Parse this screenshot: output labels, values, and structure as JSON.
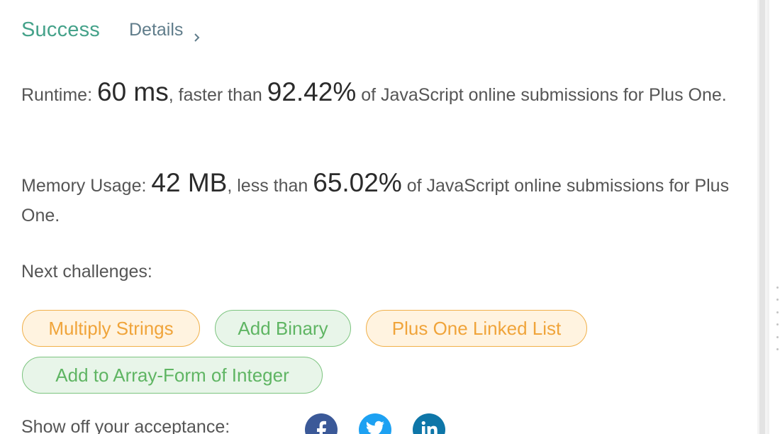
{
  "result": {
    "status": "Success",
    "details_label": "Details"
  },
  "runtime": {
    "label": "Runtime:",
    "value": "60 ms",
    "comparison_text": ", faster than",
    "percentile": "92.42%",
    "suffix": "of JavaScript online submissions for Plus One."
  },
  "memory": {
    "label": "Memory Usage:",
    "value": "42 MB",
    "comparison_text": ", less than",
    "percentile": "65.02%",
    "suffix": "of JavaScript online submissions for Plus One."
  },
  "next_challenges": {
    "label": "Next challenges:",
    "items": [
      {
        "title": "Multiply Strings",
        "difficulty_color": "#f0a43a"
      },
      {
        "title": "Add Binary",
        "difficulty_color": "#5fb563"
      },
      {
        "title": "Plus One Linked List",
        "difficulty_color": "#f0a43a"
      },
      {
        "title": "Add to Array-Form of Integer",
        "difficulty_color": "#5fb563"
      }
    ]
  },
  "share": {
    "label": "Show off your acceptance:",
    "networks": [
      {
        "icon": "facebook-icon",
        "color": "#3b5998"
      },
      {
        "icon": "twitter-icon",
        "color": "#1da1f2"
      },
      {
        "icon": "linkedin-icon",
        "color": "#0e76a8"
      }
    ]
  },
  "colors": {
    "success": "#45a28a",
    "link": "#607d8b"
  }
}
